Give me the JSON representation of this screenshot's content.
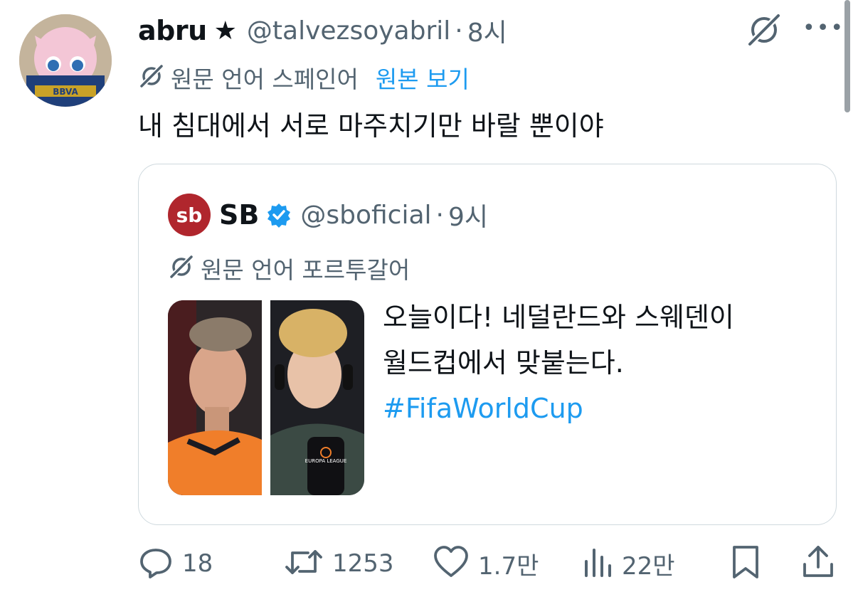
{
  "tweet": {
    "display_name": "abru",
    "star": "★",
    "handle": "@talvezsoyabril",
    "separator": "·",
    "time": "8시",
    "translation_note": "원문 언어 스페인어",
    "show_original": "원본 보기",
    "text": "내 침대에서 서로 마주치기만 바랄 뿐이야",
    "more": "•••",
    "avatar_text": "BBVA"
  },
  "quote": {
    "logo_text": "sb",
    "display_name": "SB",
    "verified": true,
    "handle": "@sboficial",
    "separator": "·",
    "time": "9시",
    "translation_note": "원문 언어 포르투갈어",
    "text_line1": "오늘이다! 네덜란드와 스웨덴이",
    "text_line2": "월드컵에서 맞붙는다.",
    "hashtag": "#FifaWorldCup",
    "mic_text": "EUROPA LEAGUE"
  },
  "actions": {
    "replies": "18",
    "retweets": "1253",
    "likes": "1.7만",
    "views": "22만"
  },
  "colors": {
    "accent": "#1d9bf0",
    "muted": "#536471",
    "border": "#cfd9de",
    "logo_red": "#b0262d"
  },
  "icons": [
    "no-translate-icon",
    "more-icon",
    "verified-icon",
    "reply-icon",
    "retweet-icon",
    "like-icon",
    "views-icon",
    "bookmark-icon",
    "share-icon"
  ]
}
